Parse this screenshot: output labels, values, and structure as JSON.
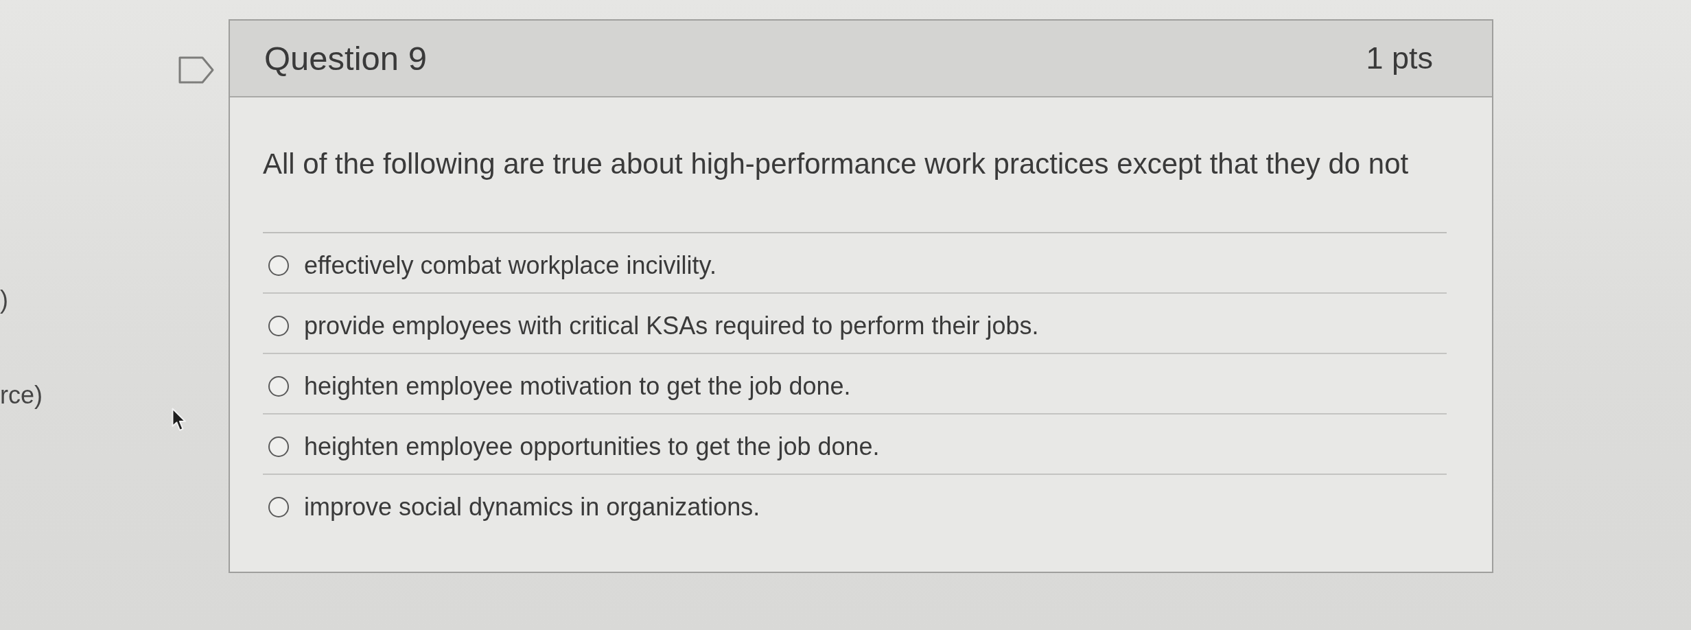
{
  "sidebar_fragments": [
    ")",
    "rce)"
  ],
  "question": {
    "title": "Question 9",
    "points": "1 pts",
    "text": "All of the following are true about high-performance work practices except that they do not",
    "options": [
      {
        "label": "effectively combat workplace incivility.",
        "selected": false
      },
      {
        "label": "provide employees with critical KSAs required to perform their jobs.",
        "selected": false
      },
      {
        "label": "heighten employee motivation to get the job done.",
        "selected": false
      },
      {
        "label": "heighten employee opportunities to get the job done.",
        "selected": false
      },
      {
        "label": "improve social dynamics in organizations.",
        "selected": false
      }
    ]
  }
}
